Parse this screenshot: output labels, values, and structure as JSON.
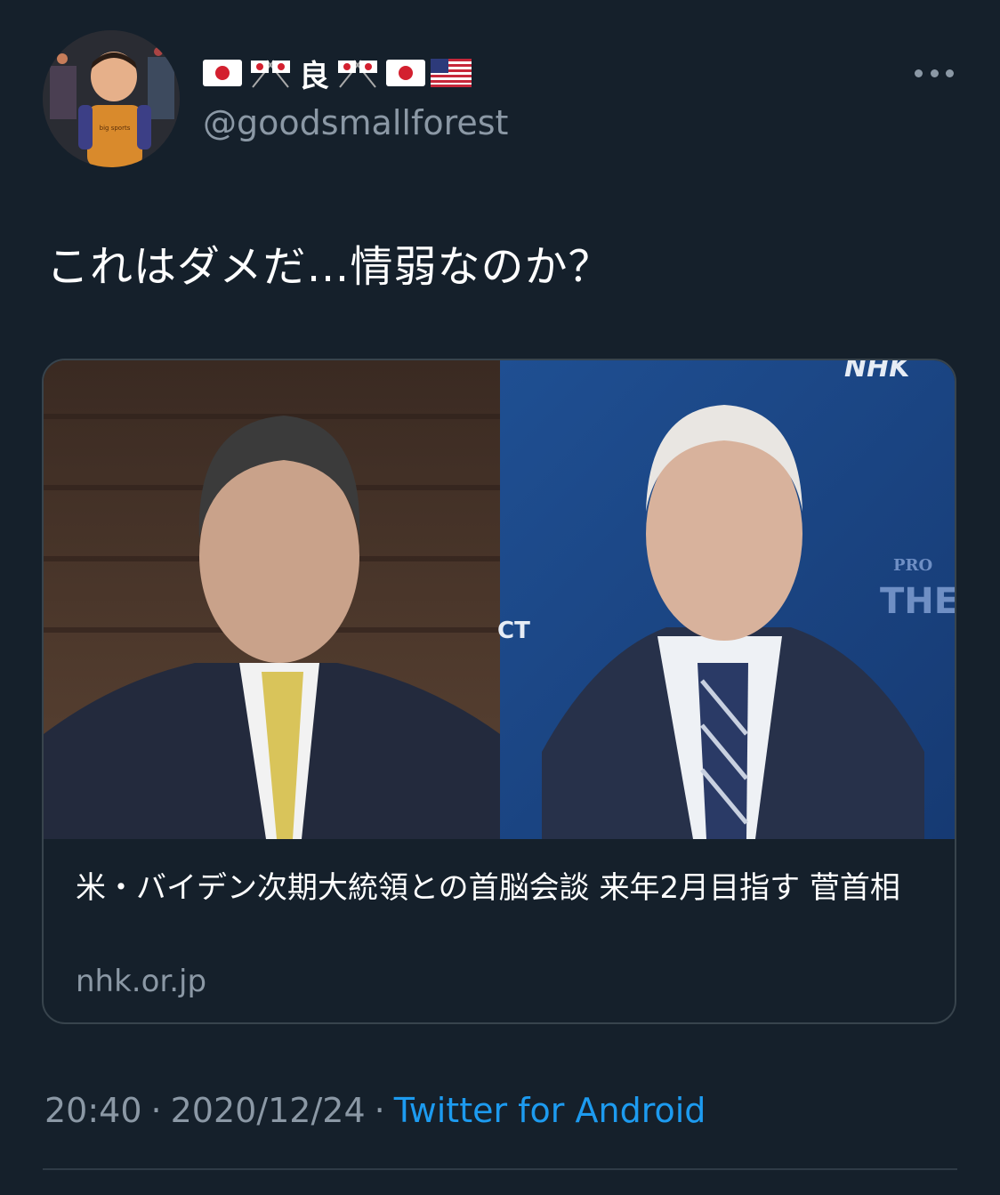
{
  "colors": {
    "background": "#15202b",
    "text": "#ffffff",
    "secondary": "#8b98a5",
    "link": "#1d9bf0",
    "border": "#38444d"
  },
  "author": {
    "name_char": "良",
    "handle": "@goodsmallforest",
    "avatar_caption": "big sports"
  },
  "tweet": {
    "text": "これはダメだ…情弱なのか？"
  },
  "card": {
    "image_watermark": "NHK",
    "backdrop_text_1": "PRO",
    "backdrop_text_2": "THE",
    "backdrop_text_3": "CT",
    "title": "米・バイデン次期大統領との首脳会談 来年2月目指す 菅首相",
    "domain": "nhk.or.jp"
  },
  "meta": {
    "time": "20:40",
    "date": "2020/12/24",
    "separator": "·",
    "source": "Twitter for Android"
  }
}
